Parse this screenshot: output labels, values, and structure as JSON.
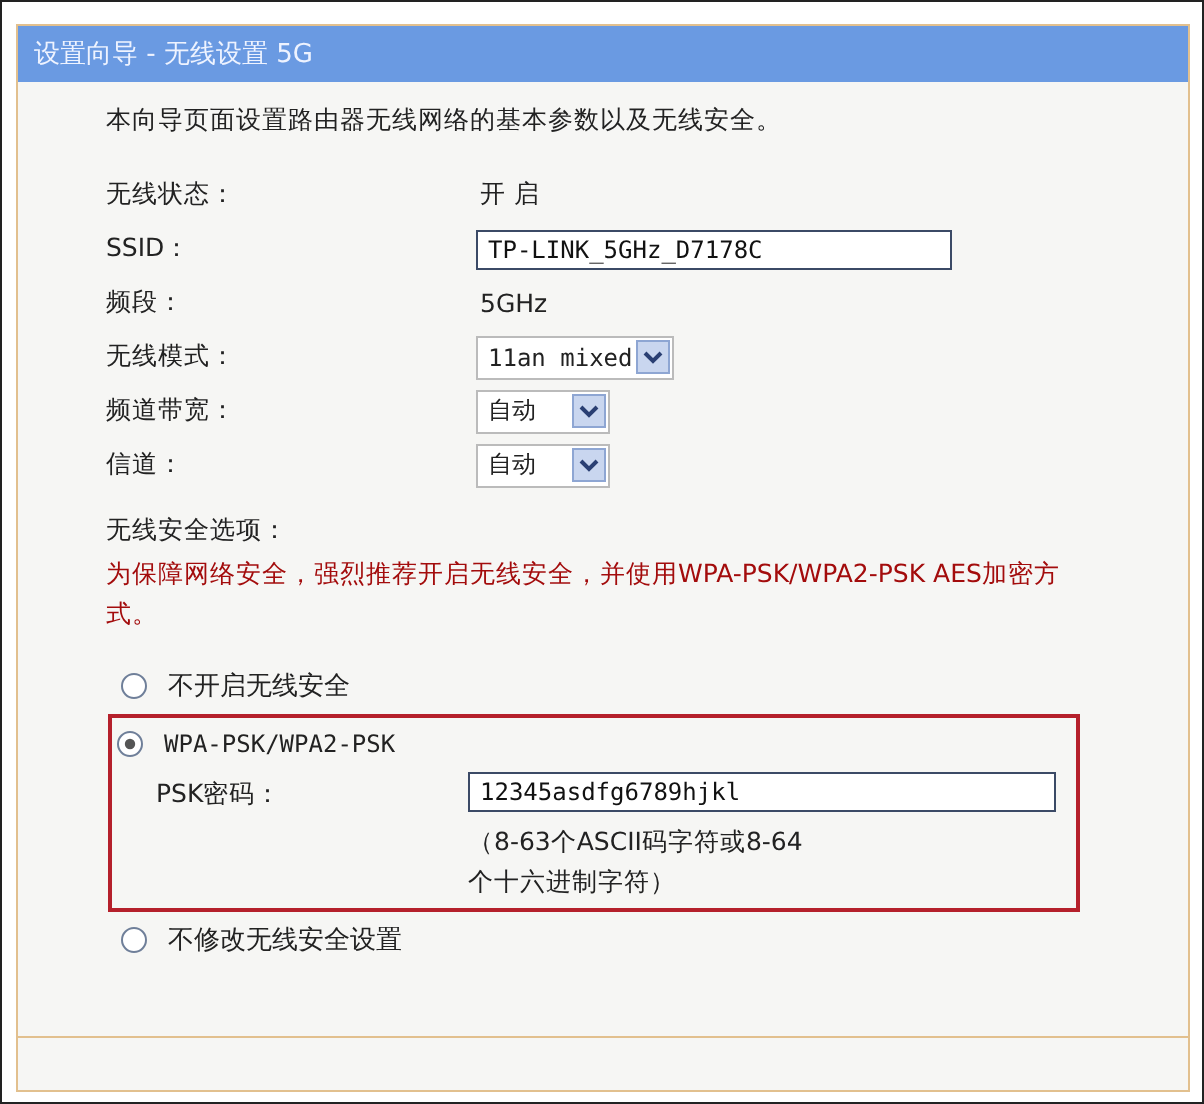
{
  "window": {
    "title": "设置向导 - 无线设置 5G"
  },
  "intro": "本向导页面设置路由器无线网络的基本参数以及无线安全。",
  "fields": [
    {
      "kind": "text",
      "label": "无线状态：",
      "value": "开 启"
    },
    {
      "kind": "input",
      "label": "SSID：",
      "value": "TP-LINK_5GHz_D7178C"
    },
    {
      "kind": "text",
      "label": "频段：",
      "value": "5GHz"
    },
    {
      "kind": "select",
      "label": "无线模式：",
      "value": "11an mixed"
    },
    {
      "kind": "select",
      "label": "频道带宽：",
      "value": "自动"
    },
    {
      "kind": "select",
      "label": "信道：",
      "value": "自动"
    }
  ],
  "security": {
    "label": "无线安全选项：",
    "warning": "为保障网络安全，强烈推荐开启无线安全，并使用WPA-PSK/WPA2-PSK AES加密方式。",
    "options": [
      {
        "label": "不开启无线安全",
        "selected": false,
        "highlighted": false
      },
      {
        "label": "WPA-PSK/WPA2-PSK",
        "selected": true,
        "highlighted": true,
        "psk": {
          "label": "PSK密码：",
          "value": "12345asdfg6789hjkl",
          "hint": "（8-63个ASCII码字符或8-64个十六进制字符）"
        }
      },
      {
        "label": "不修改无线安全设置",
        "selected": false,
        "highlighted": false
      }
    ]
  }
}
